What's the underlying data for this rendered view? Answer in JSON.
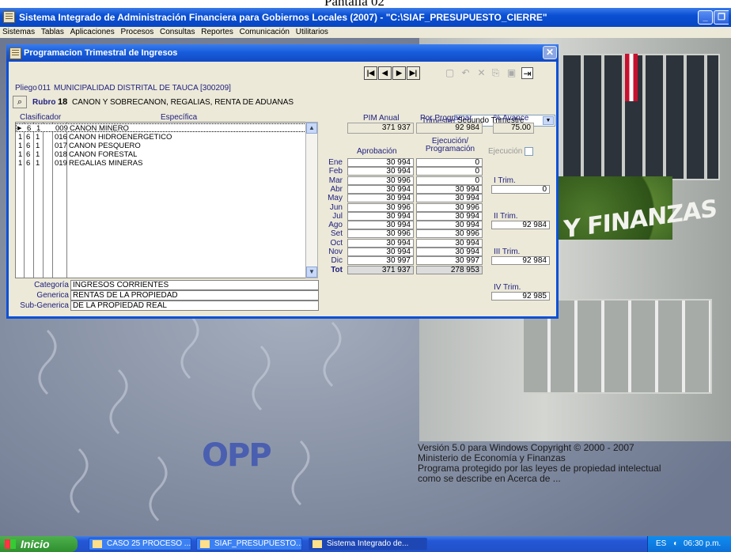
{
  "caption": "Pantalla 02",
  "window": {
    "title": "Sistema Integrado de Administración Financiera para Gobiernos Locales (2007) - \"C:\\SIAF_PRESUPUESTO_CIERRE\""
  },
  "menu": [
    "Sistemas",
    "Tablas",
    "Aplicaciones",
    "Procesos",
    "Consultas",
    "Reportes",
    "Comunicación",
    "Utilitarios"
  ],
  "dialog": {
    "title": "Programacion Trimestral de Ingresos",
    "pliego_label": "Pliego",
    "pliego_code": "011",
    "pliego_name": "MUNICIPALIDAD DISTRITAL DE TAUCA [300209]",
    "rubro_label": "Rubro",
    "rubro_code": "18",
    "rubro_name": "CANON Y SOBRECANON, REGALIAS, RENTA DE ADUANAS",
    "trimestre_label": "Trimestre",
    "trimestre_value": "Segundo Trimestre",
    "col_clasificador": "Clasificador",
    "col_especifica": "Específica",
    "rows": [
      {
        "c1": "1",
        "c2": "6",
        "c3": "1",
        "code": "009",
        "name": "CANON MINERO"
      },
      {
        "c1": "1",
        "c2": "6",
        "c3": "1",
        "code": "016",
        "name": "CANON HIDROENERGETICO"
      },
      {
        "c1": "1",
        "c2": "6",
        "c3": "1",
        "code": "017",
        "name": "CANON PESQUERO"
      },
      {
        "c1": "1",
        "c2": "6",
        "c3": "1",
        "code": "018",
        "name": "CANON FORESTAL"
      },
      {
        "c1": "1",
        "c2": "6",
        "c3": "1",
        "code": "019",
        "name": "REGALIAS MINERAS"
      }
    ],
    "categoria_label": "Categoría",
    "categoria_value": "INGRESOS CORRIENTES",
    "generica_label": "Generica",
    "generica_value": "RENTAS DE LA PROPIEDAD",
    "subgenerica_label": "Sub-Generica",
    "subgenerica_value": "DE LA PROPIEDAD REAL",
    "pim_label": "PIM Anual",
    "pim_value": "371 937",
    "por_programar_label": "Por Programar",
    "por_programar_value": "92 984",
    "avance_label": "% Avance",
    "avance_value": "75.00",
    "aprobacion_label": "Aprobación",
    "ejecucion_prog_label": "Ejecución/ Programación",
    "ejecucion_label": "Ejecución",
    "months": [
      {
        "m": "Ene",
        "a": "30 994",
        "e": "0"
      },
      {
        "m": "Feb",
        "a": "30 994",
        "e": "0"
      },
      {
        "m": "Mar",
        "a": "30 996",
        "e": "0"
      },
      {
        "m": "Abr",
        "a": "30 994",
        "e": "30 994"
      },
      {
        "m": "May",
        "a": "30 994",
        "e": "30 994"
      },
      {
        "m": "Jun",
        "a": "30 996",
        "e": "30 996"
      },
      {
        "m": "Jul",
        "a": "30 994",
        "e": "30 994"
      },
      {
        "m": "Ago",
        "a": "30 994",
        "e": "30 994"
      },
      {
        "m": "Set",
        "a": "30 996",
        "e": "30 996"
      },
      {
        "m": "Oct",
        "a": "30 994",
        "e": "30 994"
      },
      {
        "m": "Nov",
        "a": "30 994",
        "e": "30 994"
      },
      {
        "m": "Dic",
        "a": "30 997",
        "e": "30 997"
      }
    ],
    "total_label": "Tot",
    "total_aprobacion": "371 937",
    "total_ejecucion": "278 953",
    "quarters": [
      {
        "label": "I Trim.",
        "value": "0"
      },
      {
        "label": "II Trim.",
        "value": "92 984"
      },
      {
        "label": "III Trim.",
        "value": "92 984"
      },
      {
        "label": "IV Trim.",
        "value": "92 985"
      }
    ]
  },
  "desktop": {
    "ministry_text": "Y FINANZAS",
    "logo": "OPP",
    "version_lines": [
      "Versión 5.0 para Windows Copyright © 2000 - 2007",
      "Ministerio de Economía y Finanzas",
      "Programa protegido por las leyes de propiedad intelectual",
      "como se describe en Acerca de ..."
    ]
  },
  "taskbar": {
    "start": "Inicio",
    "items": [
      "CASO 25 PROCESO ...",
      "SIAF_PRESUPUESTO...",
      "Sistema Integrado de..."
    ],
    "lang": "ES",
    "time": "06:30 p.m."
  }
}
